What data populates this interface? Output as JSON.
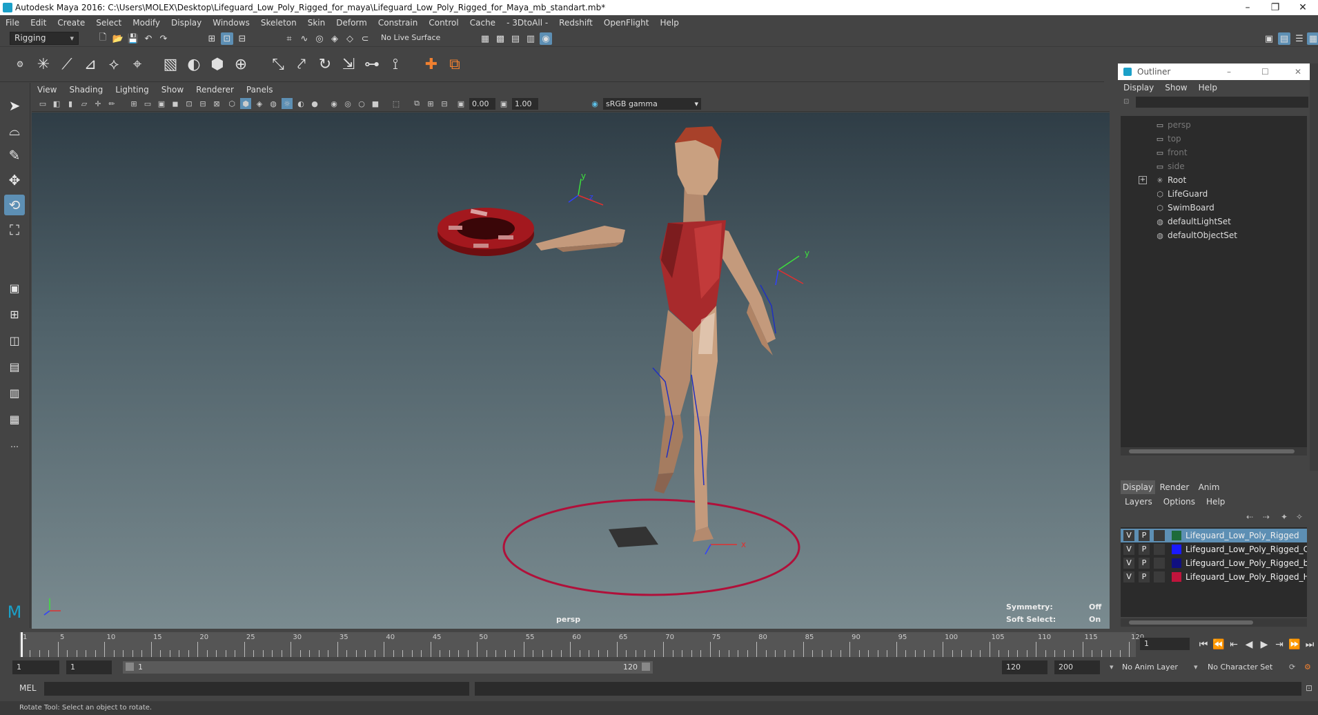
{
  "window": {
    "title": "Autodesk Maya 2016: C:\\Users\\MOLEX\\Desktop\\Lifeguard_Low_Poly_Rigged_for_maya\\Lifeguard_Low_Poly_Rigged_for_Maya_mb_standart.mb*"
  },
  "menubar": [
    "File",
    "Edit",
    "Create",
    "Select",
    "Modify",
    "Display",
    "Windows",
    "Skeleton",
    "Skin",
    "Deform",
    "Constrain",
    "Control",
    "Cache",
    "- 3DtoAll -",
    "Redshift",
    "OpenFlight",
    "Help"
  ],
  "statusline": {
    "mode": "Rigging",
    "live_surface": "No Live Surface"
  },
  "viewport": {
    "menu": [
      "View",
      "Shading",
      "Lighting",
      "Show",
      "Renderer",
      "Panels"
    ],
    "exposure": "0.00",
    "gamma_value": "1.00",
    "color_space": "sRGB gamma",
    "camera_label": "persp",
    "symmetry_label": "Symmetry:",
    "symmetry_value": "Off",
    "soft_select_label": "Soft Select:",
    "soft_select_value": "On",
    "axis_y": "y",
    "axis_z": "z",
    "axis_x": "x"
  },
  "outliner": {
    "title": "Outliner",
    "menu": [
      "Display",
      "Show",
      "Help"
    ],
    "items": [
      {
        "label": "persp",
        "icon": "camera-icon",
        "dim": true
      },
      {
        "label": "top",
        "icon": "camera-icon",
        "dim": true
      },
      {
        "label": "front",
        "icon": "camera-icon",
        "dim": true
      },
      {
        "label": "side",
        "icon": "camera-icon",
        "dim": true
      },
      {
        "label": "Root",
        "icon": "joint-icon",
        "dim": false,
        "expandable": true
      },
      {
        "label": "LifeGuard",
        "icon": "transform-icon",
        "dim": false
      },
      {
        "label": "SwimBoard",
        "icon": "transform-icon",
        "dim": false
      },
      {
        "label": "defaultLightSet",
        "icon": "set-icon",
        "dim": false
      },
      {
        "label": "defaultObjectSet",
        "icon": "set-icon",
        "dim": false
      }
    ]
  },
  "layers": {
    "tabs": [
      "Display",
      "Render",
      "Anim"
    ],
    "menu": [
      "Layers",
      "Options",
      "Help"
    ],
    "rows": [
      {
        "v": "V",
        "p": "P",
        "color": "#1d6b3a",
        "name": "Lifeguard_Low_Poly_Rigged",
        "selected": true
      },
      {
        "v": "V",
        "p": "P",
        "color": "#1a1aff",
        "name": "Lifeguard_Low_Poly_Rigged_Contro",
        "selected": false
      },
      {
        "v": "V",
        "p": "P",
        "color": "#101080",
        "name": "Lifeguard_Low_Poly_Rigged_bones",
        "selected": false
      },
      {
        "v": "V",
        "p": "P",
        "color": "#c0143c",
        "name": "Lifeguard_Low_Poly_Rigged_Helper",
        "selected": false
      }
    ]
  },
  "timeslider": {
    "labels": [
      "1",
      "5",
      "10",
      "15",
      "20",
      "25",
      "30",
      "35",
      "40",
      "45",
      "50",
      "55",
      "60",
      "65",
      "70",
      "75",
      "80",
      "85",
      "90",
      "95",
      "100",
      "105",
      "110",
      "115",
      "120"
    ],
    "current_frame": "1"
  },
  "range": {
    "start": "1",
    "playback_start": "1",
    "range_start_label": "1",
    "range_end_label": "120",
    "playback_end": "120",
    "end": "200",
    "anim_layer": "No Anim Layer",
    "character_set": "No Character Set"
  },
  "cmdline": {
    "label": "MEL"
  },
  "helpline": {
    "text": "Rotate Tool: Select an object to rotate."
  },
  "colors": {
    "accent": "#5d8fb4",
    "panel": "#444444",
    "field": "#2b2b2b",
    "circle": "#b0103a",
    "swimsuit": "#a82a2c",
    "skin": "#c49a7c"
  }
}
